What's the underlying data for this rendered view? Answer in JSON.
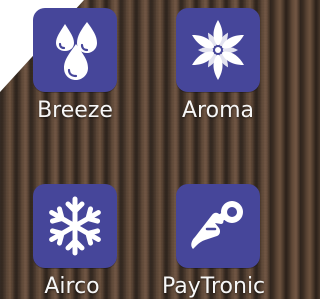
{
  "tiles": [
    {
      "label": "Breeze",
      "icon": "water-drops-icon"
    },
    {
      "label": "Aroma",
      "icon": "flower-icon"
    },
    {
      "label": "Airco",
      "icon": "snowflake-icon"
    },
    {
      "label": "PayTronic",
      "icon": "hand-coin-icon"
    }
  ],
  "colors": {
    "tile": "#46469a",
    "icon": "#ffffff",
    "text": "#f7f7f7"
  }
}
